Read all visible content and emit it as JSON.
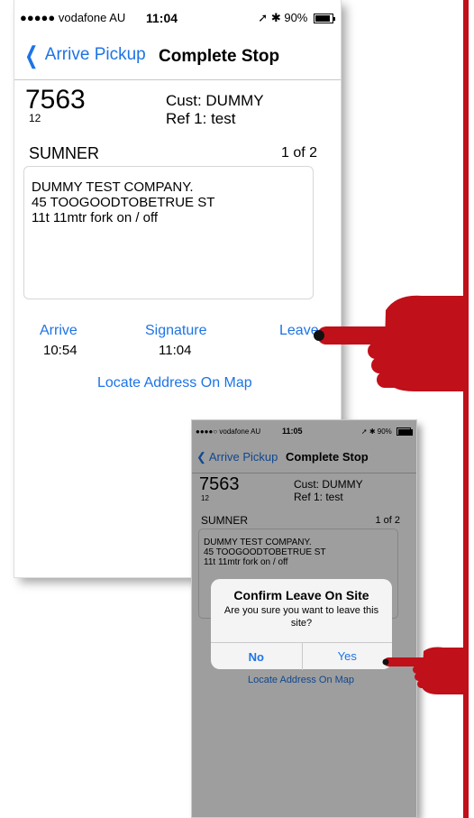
{
  "phone1": {
    "status": {
      "carrier": "●●●●● vodafone AU",
      "time": "11:04",
      "battery": "90%"
    },
    "nav": {
      "back": "Arrive Pickup",
      "title": "Complete Stop"
    },
    "job": {
      "number": "7563",
      "sub": "12",
      "cust": "Cust:  DUMMY",
      "ref": "Ref 1:  test"
    },
    "site": {
      "name": "SUMNER",
      "pager": "1 of 2"
    },
    "address": [
      "DUMMY TEST COMPANY.",
      "45 TOOGOODTOBETRUE ST",
      "11t 11mtr fork on / off"
    ],
    "actions": {
      "arrive": "Arrive",
      "arrive_time": "10:54",
      "signature": "Signature",
      "signature_time": "11:04",
      "leave": "Leave"
    },
    "locate": "Locate Address On Map"
  },
  "phone2": {
    "status": {
      "carrier": "●●●●○ vodafone AU",
      "time": "11:05",
      "battery": "90%"
    },
    "nav": {
      "back": "Arrive Pickup",
      "title": "Complete Stop"
    },
    "job": {
      "number": "7563",
      "sub": "12",
      "cust": "Cust:  DUMMY",
      "ref": "Ref 1:  test"
    },
    "site": {
      "name": "SUMNER",
      "pager": "1 of 2"
    },
    "address": [
      "DUMMY TEST COMPANY.",
      "45 TOOGOODTOBETRUE ST",
      "11t 11mtr fork on / off"
    ],
    "locate": "Locate Address On Map",
    "alert": {
      "title": "Confirm Leave On Site",
      "message": "Are you sure you want to leave this site?",
      "no": "No",
      "yes": "Yes"
    }
  },
  "colors": {
    "accent": "#1d74e6",
    "pointer": "#c0101a"
  }
}
